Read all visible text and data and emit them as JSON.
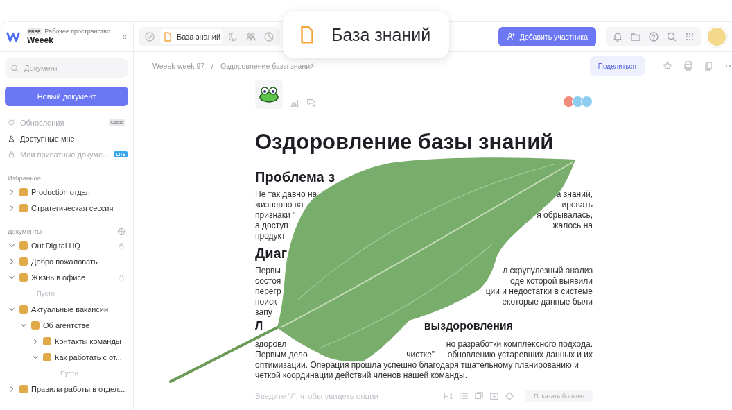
{
  "workspace": {
    "plan": "FREE",
    "caption": "Рабочее пространство",
    "name": "Weeek",
    "collapse": "«"
  },
  "search": {
    "placeholder": "Документ"
  },
  "new_button": "Новый документ",
  "nav": [
    {
      "kind": "updates",
      "label": "Обновления",
      "disabled": true,
      "badge": "Скоро"
    },
    {
      "kind": "shared",
      "label": "Доступные мне",
      "disabled": false
    },
    {
      "kind": "private",
      "label": "Мои приватные докуме...",
      "disabled": true,
      "badge": "LITE"
    }
  ],
  "favorites": {
    "title": "Избранное",
    "items": [
      {
        "label": "Production отдел",
        "expanded": false
      },
      {
        "label": "Стратегическая сессия",
        "expanded": false
      }
    ]
  },
  "documents": {
    "title": "Документы",
    "items": [
      {
        "label": "Out Digital HQ",
        "expanded": true,
        "locked": true
      },
      {
        "label": "Добро пожаловать",
        "expanded": false
      },
      {
        "label": "Жизнь в офисе",
        "expanded": true,
        "locked": true,
        "children": [
          {
            "kind": "empty",
            "label": "Пусто"
          }
        ]
      },
      {
        "label": "Актуальные вакансии",
        "expanded": true,
        "children": [
          {
            "label": "Об агентстве",
            "expanded": true,
            "children": [
              {
                "label": "Контакты команды",
                "expanded": false
              },
              {
                "label": "Как работать с от...",
                "expanded": true,
                "children": [
                  {
                    "kind": "empty",
                    "label": "Пусто"
                  }
                ]
              }
            ]
          }
        ]
      },
      {
        "label": "Правила работы в отдел...",
        "expanded": false
      }
    ]
  },
  "tabs": [
    {
      "kind": "check",
      "selected": false
    },
    {
      "kind": "doc",
      "label": "База знаний",
      "selected": true
    },
    {
      "kind": "moon",
      "selected": false
    },
    {
      "kind": "people",
      "selected": false
    },
    {
      "kind": "pie",
      "selected": false
    }
  ],
  "add_member": "Добавить участника",
  "callout": "База знаний",
  "breadcrumbs": [
    "Weeek-week 97",
    "Оздоровление базы знаний"
  ],
  "breadcrumb_separator": "/",
  "share": "Поделиться",
  "document": {
    "title": "Оздоровление базы знаний",
    "blocks": [
      {
        "kind": "heading",
        "lines": [
          {
            "left": "Проблема з"
          }
        ]
      },
      {
        "kind": "para",
        "lines": [
          {
            "left": "Не так давно на",
            "right": "а знаний,"
          },
          {
            "left": "жизненно ва",
            "right": "ировать"
          },
          {
            "left": "признаки \"",
            "right": "я обрывалась,"
          },
          {
            "left": "а доступ",
            "right": "жалось на"
          },
          {
            "left": "продукт"
          }
        ]
      },
      {
        "kind": "heading",
        "lines": [
          {
            "left": "Диаг"
          }
        ]
      },
      {
        "kind": "para",
        "lines": [
          {
            "left": "Первы",
            "right": "л скрупулезный анализ"
          },
          {
            "left": "состоя",
            "right": "оде которой выявили"
          },
          {
            "left": "перегр",
            "right": "ции и недостатки в системе"
          },
          {
            "left": "поиск",
            "right": "екоторые данные были"
          },
          {
            "left": "запу"
          }
        ]
      },
      {
        "kind": "heading",
        "lines": [
          {
            "left": "Л",
            "right": "выздоровления"
          }
        ]
      },
      {
        "kind": "para",
        "lines": [
          {
            "left": "здоровл",
            "right": "но разработки комплексного подхода."
          },
          {
            "left": "Первым дело",
            "right": "чистке\" — обновлению устаревших данных и их"
          },
          {
            "left": "оптимизации. Операция прошла успешно благодаря тщательному планированию и"
          },
          {
            "left": "четкой координации действий членов нашей команды."
          }
        ]
      }
    ],
    "input_placeholder": "Введите “/”, чтобы увидеть опции",
    "toolbar_h1": "H1",
    "show_more": "Показать больше"
  }
}
